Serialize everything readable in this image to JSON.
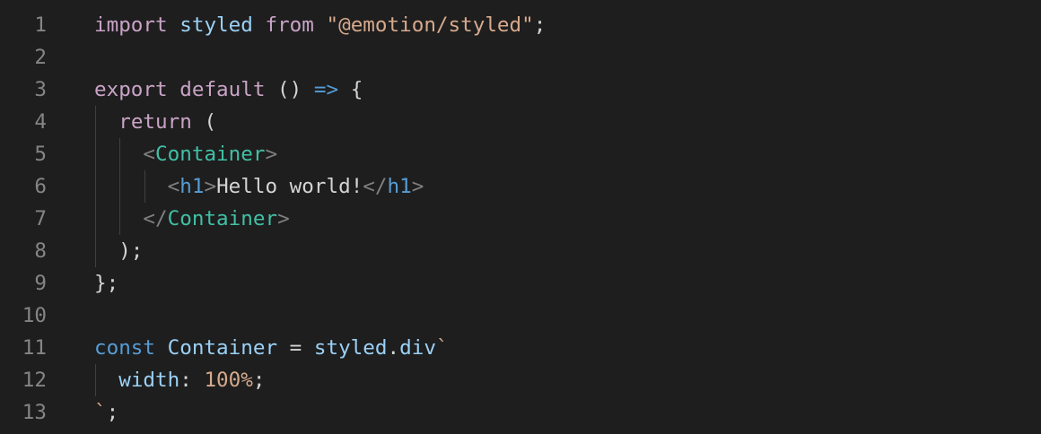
{
  "editor": {
    "theme": {
      "background": "#1e1e1e",
      "line_number_color": "#858585",
      "keyword_color": "#c9a3c6",
      "string_color": "#d7a98c",
      "identifier_color": "#9bd1f6",
      "component_color": "#41c0a5",
      "arrow_color": "#569cd6"
    },
    "lines": [
      {
        "number": "1",
        "tokens": [
          {
            "text": "import",
            "kind": "kw"
          },
          {
            "text": " ",
            "kind": "plain"
          },
          {
            "text": "styled",
            "kind": "ident"
          },
          {
            "text": " ",
            "kind": "plain"
          },
          {
            "text": "from",
            "kind": "kw"
          },
          {
            "text": " ",
            "kind": "plain"
          },
          {
            "text": "\"@emotion/styled\"",
            "kind": "str"
          },
          {
            "text": ";",
            "kind": "plain"
          }
        ]
      },
      {
        "number": "2",
        "tokens": []
      },
      {
        "number": "3",
        "tokens": [
          {
            "text": "export",
            "kind": "kw"
          },
          {
            "text": " ",
            "kind": "plain"
          },
          {
            "text": "default",
            "kind": "kw"
          },
          {
            "text": " () ",
            "kind": "plain"
          },
          {
            "text": "=>",
            "kind": "blue"
          },
          {
            "text": " {",
            "kind": "plain"
          }
        ]
      },
      {
        "number": "4",
        "tokens": [
          {
            "text": "  ",
            "kind": "plain"
          },
          {
            "text": "return",
            "kind": "kw"
          },
          {
            "text": " (",
            "kind": "plain"
          }
        ]
      },
      {
        "number": "5",
        "tokens": [
          {
            "text": "    ",
            "kind": "plain"
          },
          {
            "text": "<",
            "kind": "tag-punct"
          },
          {
            "text": "Container",
            "kind": "tag"
          },
          {
            "text": ">",
            "kind": "tag-punct"
          }
        ]
      },
      {
        "number": "6",
        "tokens": [
          {
            "text": "      ",
            "kind": "plain"
          },
          {
            "text": "<",
            "kind": "tag-punct"
          },
          {
            "text": "h1",
            "kind": "blue"
          },
          {
            "text": ">",
            "kind": "tag-punct"
          },
          {
            "text": "Hello world!",
            "kind": "plain"
          },
          {
            "text": "</",
            "kind": "tag-punct"
          },
          {
            "text": "h1",
            "kind": "blue"
          },
          {
            "text": ">",
            "kind": "tag-punct"
          }
        ]
      },
      {
        "number": "7",
        "tokens": [
          {
            "text": "    ",
            "kind": "plain"
          },
          {
            "text": "</",
            "kind": "tag-punct"
          },
          {
            "text": "Container",
            "kind": "tag"
          },
          {
            "text": ">",
            "kind": "tag-punct"
          }
        ]
      },
      {
        "number": "8",
        "tokens": [
          {
            "text": "  );",
            "kind": "plain"
          }
        ]
      },
      {
        "number": "9",
        "tokens": [
          {
            "text": "};",
            "kind": "plain"
          }
        ]
      },
      {
        "number": "10",
        "tokens": []
      },
      {
        "number": "11",
        "tokens": [
          {
            "text": "const",
            "kind": "blue"
          },
          {
            "text": " ",
            "kind": "plain"
          },
          {
            "text": "Container",
            "kind": "ident"
          },
          {
            "text": " = ",
            "kind": "plain"
          },
          {
            "text": "styled",
            "kind": "ident"
          },
          {
            "text": ".",
            "kind": "plain"
          },
          {
            "text": "div",
            "kind": "ident"
          },
          {
            "text": "`",
            "kind": "str"
          }
        ]
      },
      {
        "number": "12",
        "tokens": [
          {
            "text": "  ",
            "kind": "plain"
          },
          {
            "text": "width",
            "kind": "ident"
          },
          {
            "text": ": ",
            "kind": "plain"
          },
          {
            "text": "100%",
            "kind": "str"
          },
          {
            "text": ";",
            "kind": "plain"
          }
        ]
      },
      {
        "number": "13",
        "tokens": [
          {
            "text": "`",
            "kind": "str"
          },
          {
            "text": ";",
            "kind": "plain"
          }
        ]
      }
    ]
  }
}
